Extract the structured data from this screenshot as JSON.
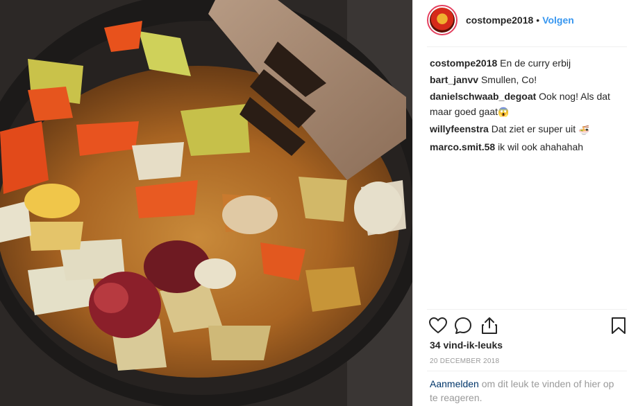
{
  "post": {
    "username": "costompe2018",
    "separator": "•",
    "follow_label": "Volgen",
    "photo_subject": "curry with vegetables and chicken in a frying pan with a wooden spatula"
  },
  "comments": [
    {
      "user": "costompe2018",
      "text": "En de curry erbij",
      "emoji": ""
    },
    {
      "user": "bart_janvv",
      "text": "Smullen, Co!",
      "emoji": ""
    },
    {
      "user": "danielschwaab_degoat",
      "text": "Ook nog! Als dat maar goed gaat",
      "emoji": "😱"
    },
    {
      "user": "willyfeenstra",
      "text": "Dat ziet er super uit",
      "emoji": "🍜"
    },
    {
      "user": "marco.smit.58",
      "text": "ik wil ook ahahahah",
      "emoji": ""
    }
  ],
  "footer": {
    "likes": "34 vind-ik-leuks",
    "date": "20 DECEMBER 2018",
    "login_link": "Aanmelden",
    "login_text": " om dit leuk te vinden of hier op te reageren."
  },
  "icons": {
    "like": "heart-icon",
    "comment": "comment-icon",
    "share": "share-icon",
    "save": "bookmark-icon"
  },
  "colors": {
    "follow": "#3897f0",
    "login_link": "#003569",
    "muted": "#999999"
  }
}
